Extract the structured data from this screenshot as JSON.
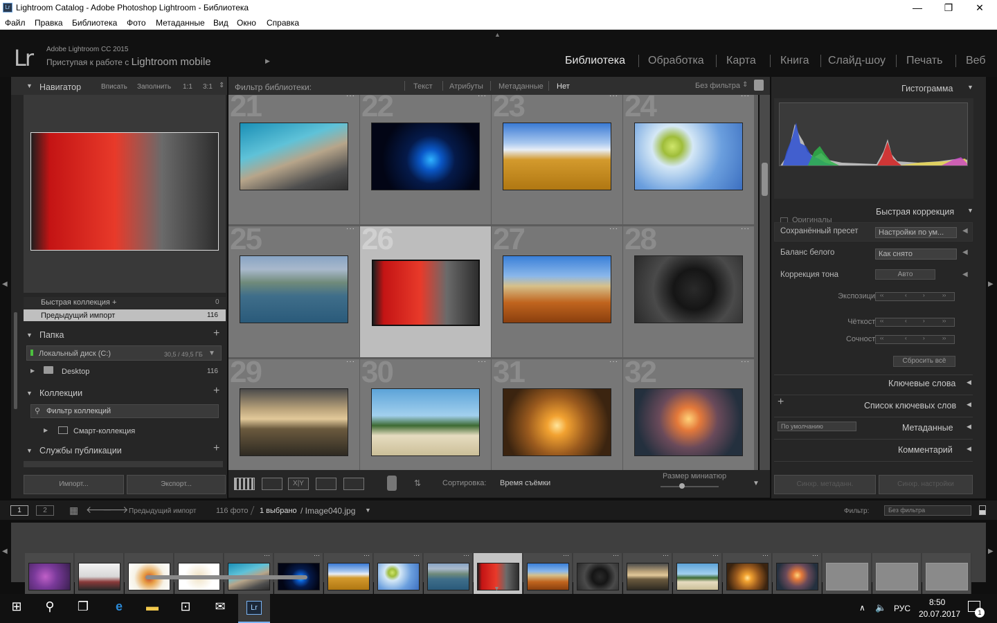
{
  "window": {
    "title": "Lightroom Catalog - Adobe Photoshop Lightroom - Библиотека",
    "icon_text": "Lr",
    "controls": [
      "—",
      "❐",
      "✕"
    ]
  },
  "menu": [
    "Файл",
    "Правка",
    "Библиотека",
    "Фото",
    "Метаданные",
    "Вид",
    "Окно",
    "Справка"
  ],
  "identity": {
    "logo": "Lr",
    "version": "Adobe Lightroom CC 2015",
    "prefix": "Приступая к работе с ",
    "mobile": "Lightroom mobile"
  },
  "modules": [
    {
      "label": "Библиотека",
      "active": true
    },
    {
      "label": "Обработка",
      "active": false
    },
    {
      "label": "Карта",
      "active": false
    },
    {
      "label": "Книга",
      "active": false
    },
    {
      "label": "Слайд-шоу",
      "active": false
    },
    {
      "label": "Печать",
      "active": false
    },
    {
      "label": "Веб",
      "active": false
    }
  ],
  "navigator": {
    "title": "Навигатор",
    "zoom_options": [
      "Вписать",
      "Заполнить",
      "1:1",
      "3:1"
    ]
  },
  "catalog": {
    "quick_collection": "Быстрая коллекция +",
    "quick_collection_count": "0",
    "previous_import": "Предыдущий импорт",
    "previous_import_count": "116"
  },
  "folders": {
    "title": "Папка",
    "disk_label": "Локальный диск (C:)",
    "disk_usage": "30,5 / 49,5 ГБ",
    "desktop": "Desktop",
    "desktop_count": "116"
  },
  "collections": {
    "title": "Коллекции",
    "filter_placeholder": "Фильтр коллекций",
    "smart": "Смарт-коллекция"
  },
  "publish": {
    "title": "Службы публикации"
  },
  "left_buttons": {
    "import": "Импорт...",
    "export": "Экспорт..."
  },
  "filter_bar": {
    "label": "Фильтр библиотеки:",
    "tabs": [
      "Текст",
      "Атрибуты",
      "Метаданные",
      "Нет"
    ],
    "preset": "Без фильтра"
  },
  "grid": {
    "cells": [
      {
        "num": "21",
        "dots": "···"
      },
      {
        "num": "22",
        "dots": "···"
      },
      {
        "num": "23",
        "dots": "···"
      },
      {
        "num": "24",
        "dots": "···"
      },
      {
        "num": "25",
        "dots": "···"
      },
      {
        "num": "26",
        "dots": ""
      },
      {
        "num": "27",
        "dots": "···"
      },
      {
        "num": "28",
        "dots": "···"
      },
      {
        "num": "29",
        "dots": "···"
      },
      {
        "num": "30",
        "dots": "···"
      },
      {
        "num": "31",
        "dots": "···"
      },
      {
        "num": "32",
        "dots": "···"
      }
    ]
  },
  "toolbar": {
    "sort_label": "Сортировка:",
    "sort_value": "Время съёмки",
    "thumb_size": "Размер миниатюр"
  },
  "histogram": {
    "title": "Гистограмма",
    "originals": "Оригиналы"
  },
  "quick_develop": {
    "title": "Быстрая коррекция",
    "saved_preset_label": "Сохранённый пресет",
    "saved_preset_value": "Настройки по ум...",
    "wb_label": "Баланс белого",
    "wb_value": "Как снято",
    "tone_label": "Коррекция тона",
    "auto": "Авто",
    "exposure": "Экспозиция",
    "clarity": "Чёткость",
    "vibrance": "Сочность",
    "reset_all": "Сбросить всё"
  },
  "right_sections": {
    "keywords": "Ключевые слова",
    "keyword_list": "Список ключевых слов",
    "metadata_preset": "По умолчанию",
    "metadata": "Метаданные",
    "comments": "Комментарий"
  },
  "sync_buttons": {
    "meta": "Синхр. метаданн.",
    "settings": "Синхр. настройки"
  },
  "filmstrip_bar": {
    "page1": "1",
    "page2": "2",
    "source": "Предыдущий импорт",
    "count": "116 фото",
    "selected": "1 выбрано",
    "file": "/ Image040.jpg",
    "filter_label": "Фильтр:",
    "filter_value": "Без фильтра"
  },
  "taskbar": {
    "lang": "РУС",
    "time": "8:50",
    "date": "20.07.2017",
    "notif_count": "1"
  },
  "colors": {
    "panel": "#2b2b2b",
    "grid_cell": "#777777",
    "selected_cell": "#bdbdbd",
    "active_module": "#e6e6e6"
  }
}
